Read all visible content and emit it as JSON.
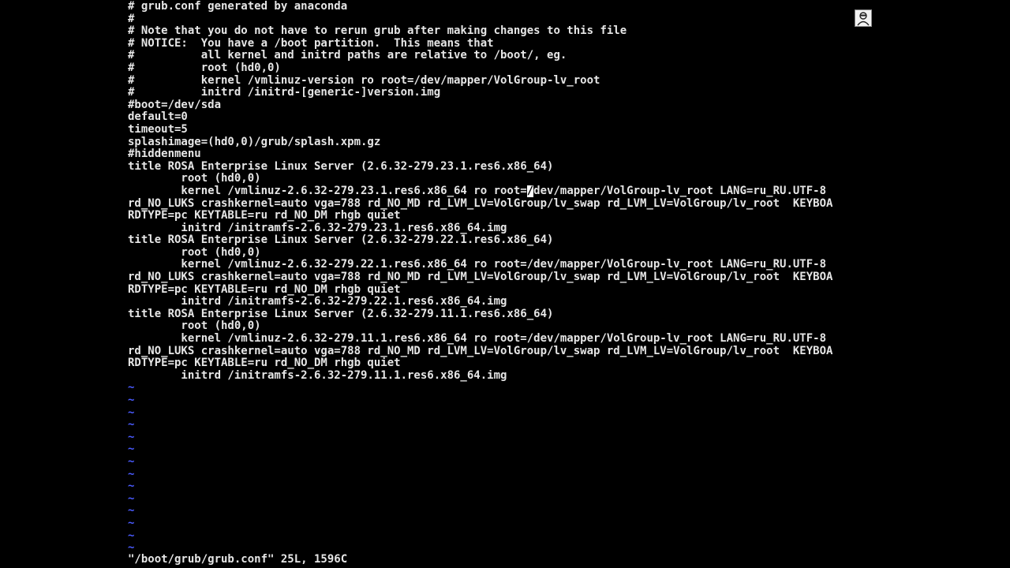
{
  "editor": {
    "lines": [
      "# grub.conf generated by anaconda",
      "#",
      "# Note that you do not have to rerun grub after making changes to this file",
      "# NOTICE:  You have a /boot partition.  This means that",
      "#          all kernel and initrd paths are relative to /boot/, eg.",
      "#          root (hd0,0)",
      "#          kernel /vmlinuz-version ro root=/dev/mapper/VolGroup-lv_root",
      "#          initrd /initrd-[generic-]version.img",
      "#boot=/dev/sda",
      "default=0",
      "timeout=5",
      "splashimage=(hd0,0)/grub/splash.xpm.gz",
      "#hiddenmenu",
      "title ROSA Enterprise Linux Server (2.6.32-279.23.1.res6.x86_64)",
      "        root (hd0,0)",
      "        kernel /vmlinuz-2.6.32-279.23.1.res6.x86_64 ro root=/dev/mapper/VolGroup-lv_root LANG=ru_RU.UTF-8",
      "rd_NO_LUKS crashkernel=auto vga=788 rd_NO_MD rd_LVM_LV=VolGroup/lv_swap rd_LVM_LV=VolGroup/lv_root  KEYBOA",
      "RDTYPE=pc KEYTABLE=ru rd_NO_DM rhgb quiet",
      "        initrd /initramfs-2.6.32-279.23.1.res6.x86_64.img",
      "title ROSA Enterprise Linux Server (2.6.32-279.22.1.res6.x86_64)",
      "        root (hd0,0)",
      "        kernel /vmlinuz-2.6.32-279.22.1.res6.x86_64 ro root=/dev/mapper/VolGroup-lv_root LANG=ru_RU.UTF-8",
      "rd_NO_LUKS crashkernel=auto vga=788 rd_NO_MD rd_LVM_LV=VolGroup/lv_swap rd_LVM_LV=VolGroup/lv_root  KEYBOA",
      "RDTYPE=pc KEYTABLE=ru rd_NO_DM rhgb quiet",
      "        initrd /initramfs-2.6.32-279.22.1.res6.x86_64.img",
      "title ROSA Enterprise Linux Server (2.6.32-279.11.1.res6.x86_64)",
      "        root (hd0,0)",
      "        kernel /vmlinuz-2.6.32-279.11.1.res6.x86_64 ro root=/dev/mapper/VolGroup-lv_root LANG=ru_RU.UTF-8",
      "rd_NO_LUKS crashkernel=auto vga=788 rd_NO_MD rd_LVM_LV=VolGroup/lv_swap rd_LVM_LV=VolGroup/lv_root  KEYBOA",
      "RDTYPE=pc KEYTABLE=ru rd_NO_DM rhgb quiet",
      "        initrd /initramfs-2.6.32-279.11.1.res6.x86_64.img"
    ],
    "cursor_line_before": "        kernel /vmlinuz-2.6.32-279.23.1.res6.x86_64 ro root=",
    "cursor_char": "/",
    "cursor_line_after": "dev/mapper/VolGroup-lv_root LANG=ru_RU.UTF-8",
    "empty_line_marker": "~",
    "status": "\"/boot/grub/grub.conf\" 25L, 1596C"
  },
  "colors": {
    "background": "#000000",
    "text": "#e6e6e6",
    "tilde": "#4a5bff",
    "cursor": "#ffffff"
  },
  "icons": {
    "corner": "avatar-icon"
  }
}
